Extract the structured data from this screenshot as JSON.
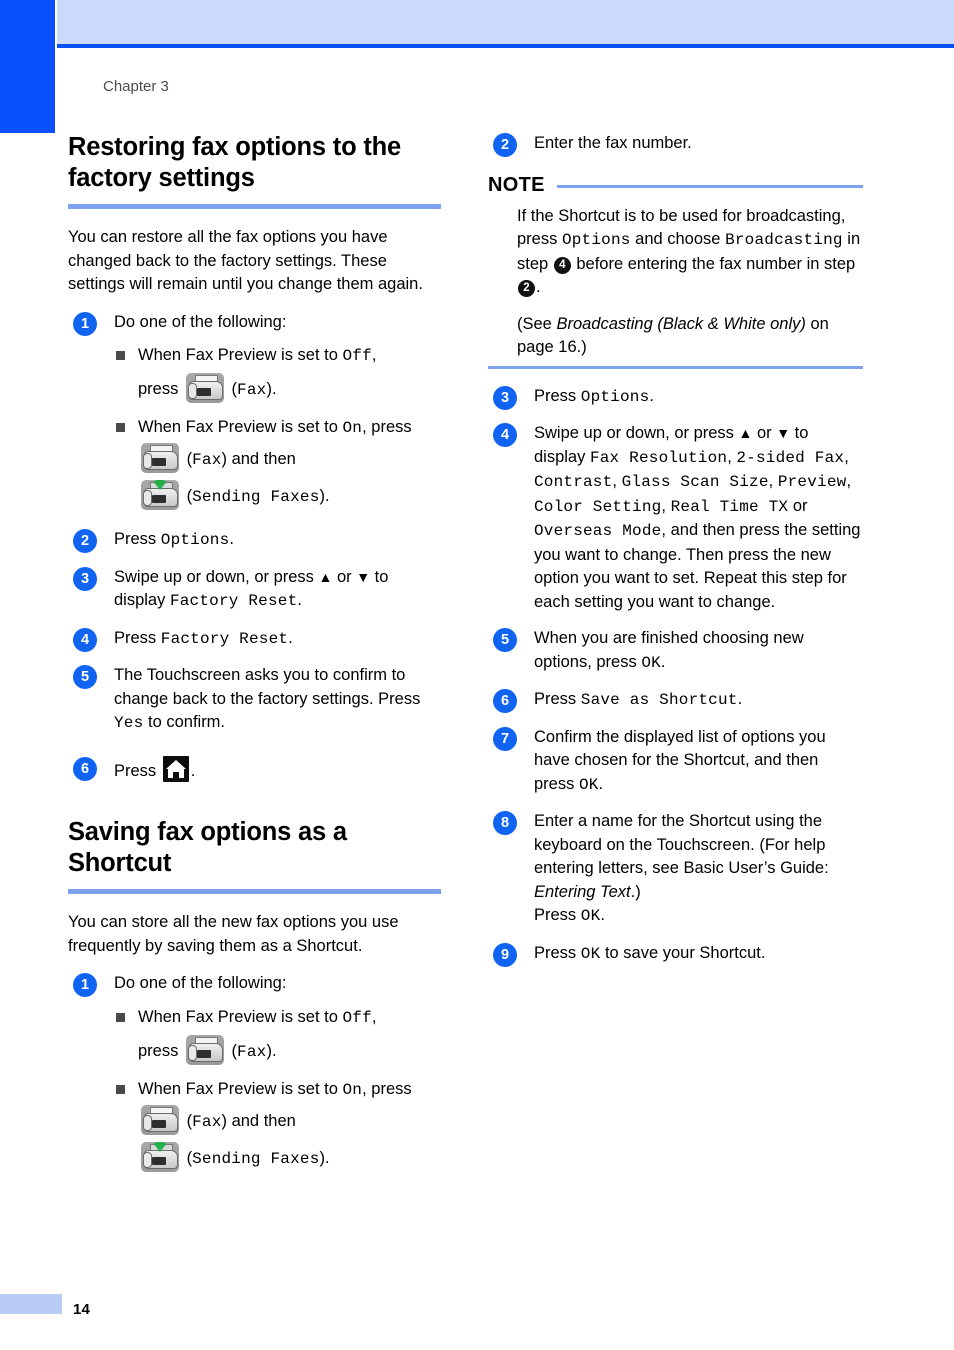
{
  "page": {
    "chapter_label": "Chapter 3",
    "page_number": "14"
  },
  "left_column": {
    "section1": {
      "title": "Restoring fax options to the factory settings",
      "intro": "You can restore all the fax options you have changed back to the factory settings. These settings will remain until you change them again.",
      "steps": {
        "s1_num": "1",
        "s1_text": "Do one of the following:",
        "b1_prefix": "When Fax Preview is set to ",
        "b1_off": "Off",
        "b1_comma": ",",
        "b1_press": "press",
        "b1_paren_open": "(",
        "b1_fax": "Fax",
        "b1_paren_close": ").",
        "b2_prefix": "When Fax Preview is set to ",
        "b2_on": "On",
        "b2_suffix": ", press",
        "b2_fax_label": "Fax",
        "b2_and_then": ") and then",
        "b2_sending_label": "Sending Faxes",
        "b2_end": ").",
        "s2_num": "2",
        "s2_press": "Press ",
        "s2_options": "Options",
        "s2_period": ".",
        "s3_num": "3",
        "s3_line1_a": "Swipe up or down, or press ",
        "s3_up": "▲",
        "s3_or": " or ",
        "s3_down": "▼",
        "s3_line1_b": " to",
        "s3_line2_a": "display ",
        "s3_factory_reset": "Factory Reset",
        "s3_line2_b": ".",
        "s4_num": "4",
        "s4_press": "Press ",
        "s4_factory_reset": "Factory Reset",
        "s4_period": ".",
        "s5_num": "5",
        "s5_text_a": "The Touchscreen asks you to confirm to change back to the factory settings. Press ",
        "s5_yes": "Yes",
        "s5_text_b": " to confirm.",
        "s6_num": "6",
        "s6_press": "Press ",
        "s6_period": "."
      }
    },
    "section2": {
      "title": "Saving fax options as a Shortcut",
      "intro": "You can store all the new fax options you use frequently by saving them as a Shortcut.",
      "steps": {
        "s1_num": "1",
        "s1_text": "Do one of the following:",
        "b1_prefix": "When Fax Preview is set to ",
        "b1_off": "Off",
        "b1_comma": ",",
        "b1_press": "press",
        "b1_paren_open": "(",
        "b1_fax": "Fax",
        "b1_paren_close": ").",
        "b2_prefix": "When Fax Preview is set to ",
        "b2_on": "On",
        "b2_suffix": ", press",
        "b2_fax_label": "Fax",
        "b2_and_then": ") and then",
        "b2_sending_label": "Sending Faxes",
        "b2_end": ")."
      }
    }
  },
  "right_column": {
    "step2": {
      "num": "2",
      "text": "Enter the fax number."
    },
    "note": {
      "title": "NOTE",
      "p1_a": "If the Shortcut is to be used for broadcasting, press ",
      "p1_options": "Options",
      "p1_b": " and choose ",
      "p1_broadcasting": "Broadcasting",
      "p1_c": " in step ",
      "p1_step4": "4",
      "p1_d": " before entering the fax number in step ",
      "p1_step2": "2",
      "p1_e": ".",
      "p2_a": "(See ",
      "p2_italic": "Broadcasting (Black & White only)",
      "p2_b": " on page 16.)"
    },
    "step3": {
      "num": "3",
      "press": "Press ",
      "options": "Options",
      "period": "."
    },
    "step4": {
      "num": "4",
      "l1_a": "Swipe up or down, or press ",
      "up": "▲",
      "or": " or ",
      "down": "▼",
      "l1_b": " to",
      "l2_a": "display ",
      "opt_fax_resolution": "Fax Resolution",
      "comma1": ",",
      "opt_2sided_fax": "2-sided Fax",
      "comma2": ",",
      "opt_contrast": "Contrast",
      "comma3": ",",
      "opt_glass_scan_size": "Glass Scan Size",
      "comma4": ",",
      "opt_preview": "Preview",
      "comma5": ",",
      "opt_color_setting": "Color Setting",
      "comma6": ",",
      "opt_real_time_tx": "Real Time TX",
      "or_word": " or ",
      "opt_overseas_mode": "Overseas Mode",
      "tail": ", and then press the setting you want to change. Then press the new option you want to set. Repeat this step for each setting you want to change."
    },
    "step5": {
      "num": "5",
      "text_a": "When you are finished choosing new options, press ",
      "ok": "OK",
      "text_b": "."
    },
    "step6": {
      "num": "6",
      "press": "Press ",
      "save_as_shortcut": "Save as Shortcut",
      "period": "."
    },
    "step7": {
      "num": "7",
      "text_a": "Confirm the displayed list of options  you have chosen for the Shortcut, and then press ",
      "ok": "OK",
      "text_b": "."
    },
    "step8": {
      "num": "8",
      "text_a": "Enter a name for the Shortcut using the keyboard on the Touchscreen. (For help entering letters, see Basic User’s Guide: ",
      "italic": "Entering Text",
      "text_b": ".)",
      "text_c": "Press ",
      "ok": "OK",
      "text_d": "."
    },
    "step9": {
      "num": "9",
      "text_a": "Press ",
      "ok": "OK",
      "text_b": " to save your Shortcut."
    }
  }
}
